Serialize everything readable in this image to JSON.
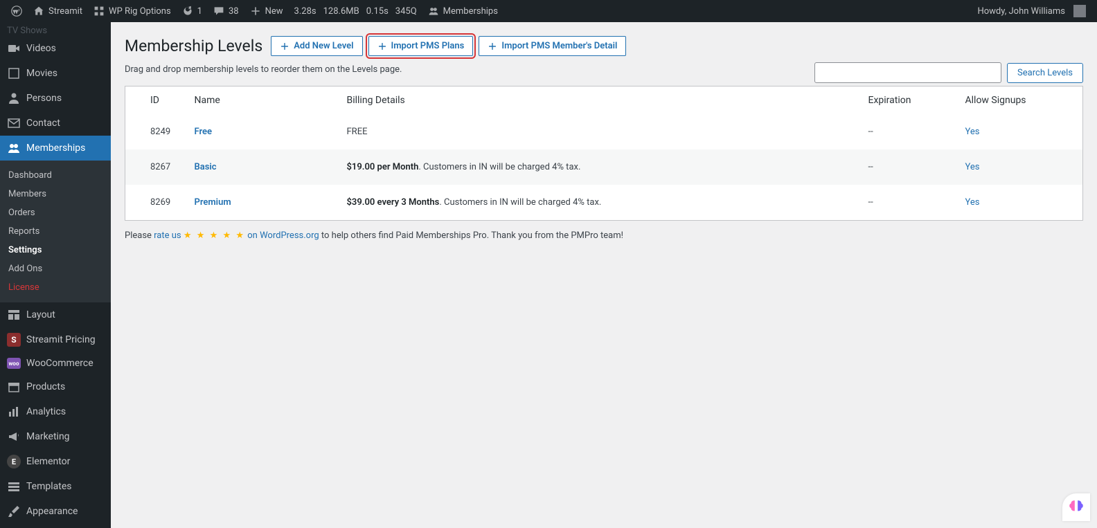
{
  "adminbar": {
    "site": "Streamit",
    "rig": "WP Rig Options",
    "refresh": "1",
    "comments": "38",
    "new": "New",
    "perf1": "3.28s",
    "perf2": "128.6MB",
    "perf3": "0.15s",
    "perf4": "345Q",
    "memberships": "Memberships",
    "greeting": "Howdy, John Williams"
  },
  "sidebar": {
    "cut": "TV Shows",
    "items": {
      "videos": "Videos",
      "movies": "Movies",
      "persons": "Persons",
      "contact": "Contact",
      "memberships": "Memberships",
      "layout": "Layout",
      "pricing": "Streamit Pricing",
      "woo": "WooCommerce",
      "products": "Products",
      "analytics": "Analytics",
      "marketing": "Marketing",
      "elementor": "Elementor",
      "templates": "Templates",
      "appearance": "Appearance"
    },
    "sub": {
      "dashboard": "Dashboard",
      "members": "Members",
      "orders": "Orders",
      "reports": "Reports",
      "settings": "Settings",
      "addons": "Add Ons",
      "license": "License"
    }
  },
  "page": {
    "title": "Membership Levels",
    "add": "Add New Level",
    "import_plans": "Import PMS Plans",
    "import_members": "Import PMS Member's Detail",
    "desc": "Drag and drop membership levels to reorder them on the Levels page.",
    "search_btn": "Search Levels"
  },
  "table": {
    "headers": {
      "id": "ID",
      "name": "Name",
      "billing": "Billing Details",
      "exp": "Expiration",
      "allow": "Allow Signups"
    },
    "rows": [
      {
        "id": "8249",
        "name": "Free",
        "billing_bold": "FREE",
        "billing_rest": "",
        "exp": "--",
        "allow": "Yes"
      },
      {
        "id": "8267",
        "name": "Basic",
        "billing_bold": "$19.00 per Month",
        "billing_rest": ". Customers in IN will be charged 4% tax.",
        "exp": "--",
        "allow": "Yes"
      },
      {
        "id": "8269",
        "name": "Premium",
        "billing_bold": "$39.00 every 3 Months",
        "billing_rest": ". Customers in IN will be charged 4% tax.",
        "exp": "--",
        "allow": "Yes"
      }
    ]
  },
  "footer": {
    "pre": "Please ",
    "rate": "rate us ",
    "stars": "★ ★ ★ ★ ★",
    "on": " on WordPress.org",
    "post": " to help others find Paid Memberships Pro. Thank you from the PMPro team!"
  }
}
